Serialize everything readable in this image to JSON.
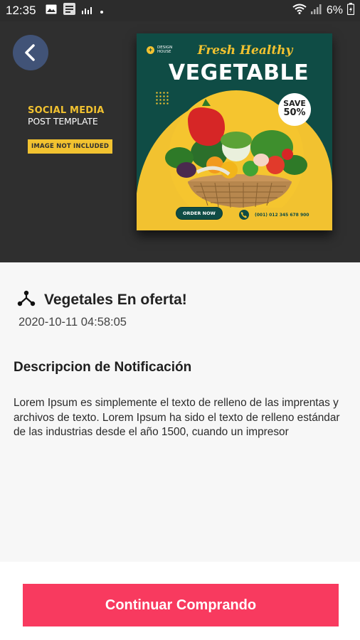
{
  "status_bar": {
    "time": "12:35",
    "battery_percent": "6%",
    "icons": [
      "gallery-icon",
      "app-icon",
      "equalizer-icon",
      "dot-icon",
      "wifi-icon",
      "signal-icon",
      "battery-icon"
    ]
  },
  "banner": {
    "back_icon": "chevron-left-icon",
    "promo_title": "SOCIAL MEDIA",
    "promo_subtitle": "POST TEMPLATE",
    "promo_tag": "IMAGE NOT INCLUDED",
    "poster": {
      "brand_line1": "DESIGN",
      "brand_line2": "HOUSE",
      "tagline": "Fresh Healthy",
      "title": "VEGETABLE",
      "save_line1": "SAVE",
      "save_line2": "50%",
      "order_label": "ORDER NOW",
      "phone": "(001) 012 345 678 900",
      "colors": {
        "background": "#0f4c45",
        "accent": "#f2c230"
      }
    }
  },
  "notification": {
    "icon": "share-icon",
    "title": "Vegetales En oferta!",
    "timestamp": "2020-10-11 04:58:05",
    "description_heading": "Descripcion de Notificación",
    "description_body": "Lorem Ipsum es simplemente el texto de relleno de las imprentas y archivos de texto. Lorem Ipsum ha sido el texto de relleno estándar de las industrias desde el año 1500, cuando un impresor"
  },
  "actions": {
    "continue_label": "Continuar Comprando",
    "accent_color": "#f83a5f"
  }
}
